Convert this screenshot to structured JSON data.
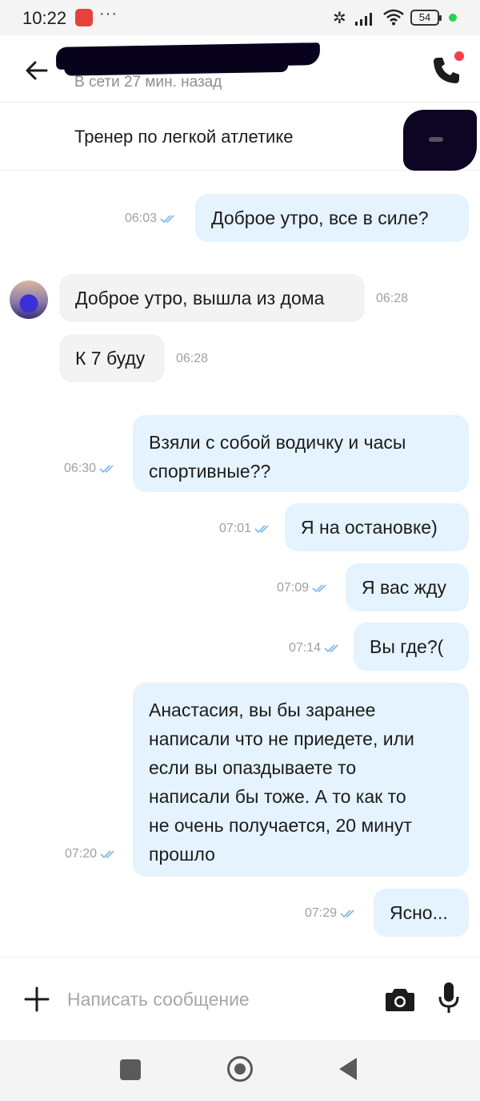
{
  "status_bar": {
    "time": "10:22",
    "dots": "···",
    "battery": "54",
    "bluetooth_glyph": "✲"
  },
  "header": {
    "contact_status": "В сети 27 мин. назад"
  },
  "item": {
    "title": "Тренер по легкой атлетике"
  },
  "messages": [
    {
      "direction": "out",
      "text": "Доброе утро, все в силе?",
      "time": "06:03"
    },
    {
      "direction": "in",
      "text": "Доброе утро, вышла из дома",
      "time": "06:28"
    },
    {
      "direction": "in",
      "text": "К 7 буду",
      "time": "06:28"
    },
    {
      "direction": "out",
      "text": "Взяли с собой водичку и часы\nспортивные??",
      "time": "06:30"
    },
    {
      "direction": "out",
      "text": "Я на остановке)",
      "time": "07:01"
    },
    {
      "direction": "out",
      "text": "Я вас жду",
      "time": "07:09"
    },
    {
      "direction": "out",
      "text": "Вы где?(",
      "time": "07:14"
    },
    {
      "direction": "out",
      "text": "Анастасия, вы бы заранее\nнаписали что не приедете, или\nесли вы опаздываете то\nнаписали бы тоже. А то как то\nне очень получается, 20 минут\nпрошло",
      "time": "07:20"
    },
    {
      "direction": "out",
      "text": "Ясно...",
      "time": "07:29"
    }
  ],
  "composer": {
    "placeholder": "Написать сообщение"
  },
  "colors": {
    "outgoing_bubble": "#e4f3fd",
    "incoming_bubble": "#f3f3f3",
    "read_ticks": "#7fb6e6",
    "notification_dot": "#ff3b4a"
  },
  "icons": {
    "back": "arrow-left-icon",
    "call": "phone-icon",
    "attach": "plus-icon",
    "camera": "camera-icon",
    "mic": "microphone-icon",
    "read": "double-check-icon"
  }
}
